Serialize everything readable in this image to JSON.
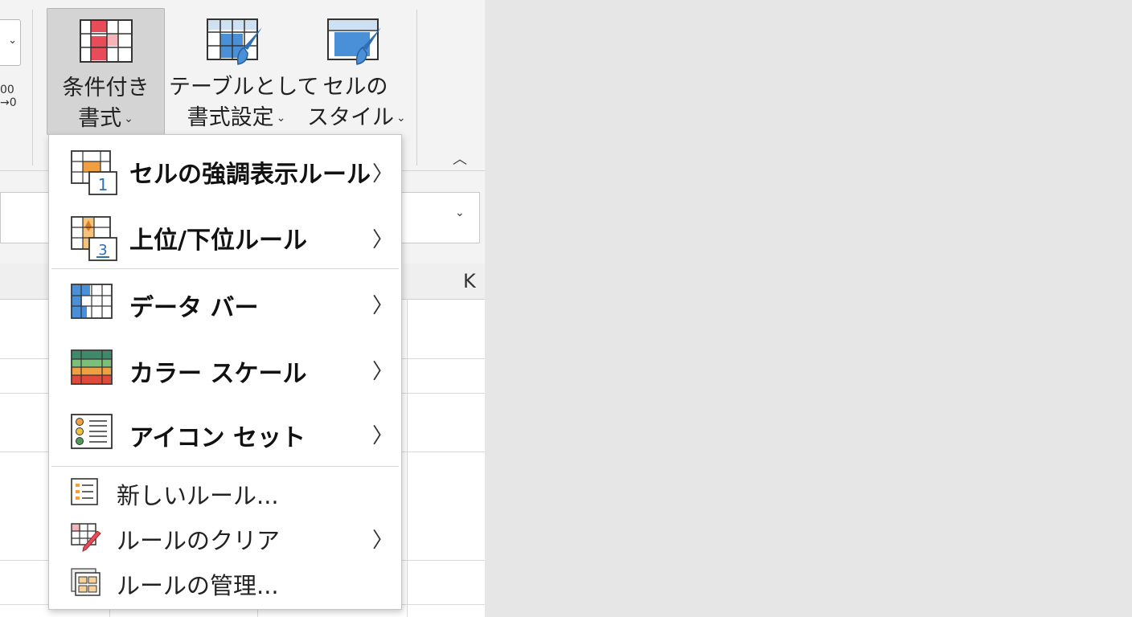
{
  "ribbon": {
    "conditional_format": {
      "line1": "条件付き",
      "line2": "書式"
    },
    "format_as_table": {
      "line1": "テーブルとして",
      "line2": "書式設定"
    },
    "cell_styles": {
      "line1": "セルの",
      "line2": "スタイル"
    },
    "decimal_top": "00",
    "decimal_bottom": "→0",
    "chevron": "⌄",
    "collapse": "︿"
  },
  "sheet": {
    "column_label": "K"
  },
  "menu": {
    "items": [
      {
        "label": "セルの強調表示ルール",
        "icon": "highlight-cells-icon",
        "submenu": true
      },
      {
        "label": "上位/下位ルール",
        "icon": "top-bottom-icon",
        "submenu": true
      },
      {
        "label": "データ バー",
        "icon": "data-bar-icon",
        "submenu": true
      },
      {
        "label": "カラー スケール",
        "icon": "color-scale-icon",
        "submenu": true
      },
      {
        "label": "アイコン セット",
        "icon": "icon-set-icon",
        "submenu": true
      },
      {
        "label": "新しいルール...",
        "icon": "new-rule-icon",
        "submenu": false
      },
      {
        "label": "ルールのクリア",
        "icon": "clear-rule-icon",
        "submenu": true
      },
      {
        "label": "ルールの管理...",
        "icon": "manage-rule-icon",
        "submenu": false
      }
    ],
    "submenu_arrow": "〉"
  },
  "colors": {
    "accent_red": "#e84c59",
    "accent_blue": "#4a90d9",
    "accent_green": "#4f9a5b",
    "accent_orange": "#f0a040"
  }
}
